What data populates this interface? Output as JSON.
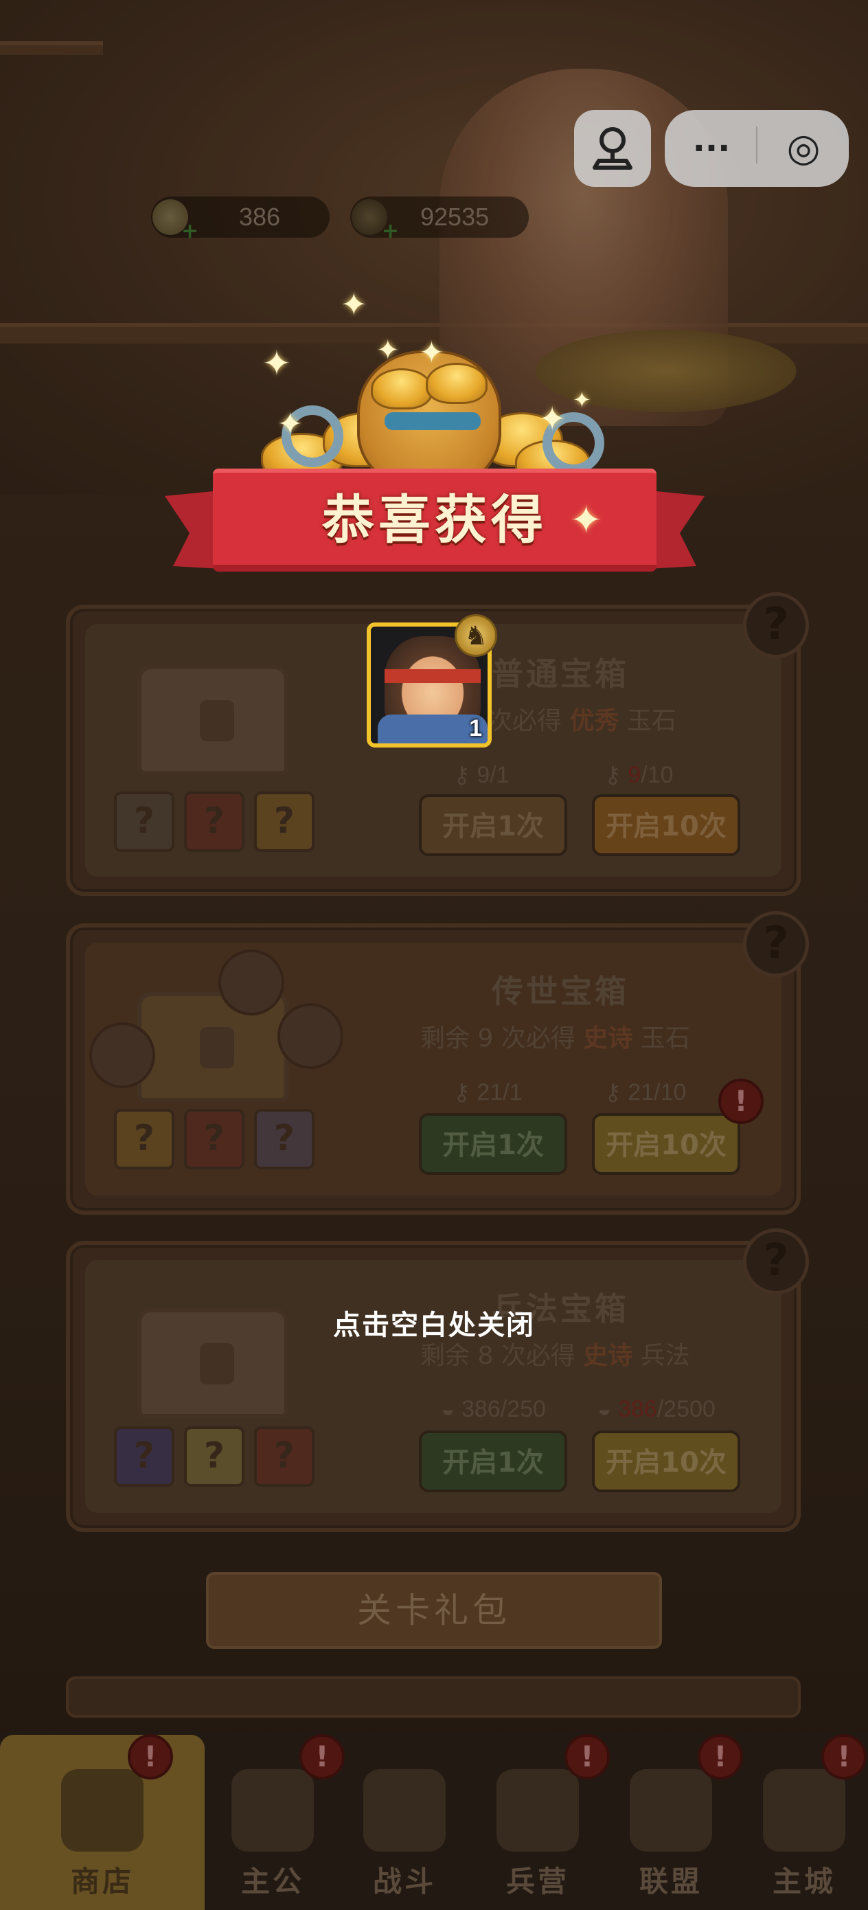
{
  "resources": {
    "ingot_count": "386",
    "coin_count": "92535"
  },
  "capsule": {
    "more_glyph": "···",
    "close_glyph": "◎"
  },
  "reward_popup": {
    "title": "恭喜获得",
    "item": {
      "type": "hero",
      "count": "1"
    },
    "close_hint": "点击空白处关闭"
  },
  "boxes": [
    {
      "title": "普通宝箱",
      "sub_pre": "次必得",
      "sub_bold": "优秀",
      "sub_post": "玉石",
      "key_single": "9/1",
      "key_multi_red": "9",
      "key_multi_rest": "/10",
      "open_one": "开启1次",
      "open_ten": "开启10次"
    },
    {
      "title": "传世宝箱",
      "sub_pre": "剩余 9 次必得",
      "sub_bold": "史诗",
      "sub_post": "玉石",
      "key_single": "21/1",
      "key_multi": "21/10",
      "open_one": "开启1次",
      "open_ten": "开启10次"
    },
    {
      "title": "兵法宝箱",
      "sub_pre": "剩余 8 次必得",
      "sub_bold": "史诗",
      "sub_post": "兵法",
      "key_single": "386/250",
      "key_multi_red": "386",
      "key_multi_rest": "/2500",
      "open_one": "开启1次",
      "open_ten": "开启10次"
    }
  ],
  "level_pack": "关卡礼包",
  "nav": [
    {
      "label": "商店",
      "active": true,
      "badge": "!"
    },
    {
      "label": "主公",
      "active": false,
      "badge": "!"
    },
    {
      "label": "战斗",
      "active": false
    },
    {
      "label": "兵营",
      "active": false,
      "badge": "!"
    },
    {
      "label": "联盟",
      "active": false,
      "badge": "!"
    },
    {
      "label": "主城",
      "active": false,
      "badge": "!"
    }
  ],
  "colors": {
    "ribbon_red": "#d7323b",
    "card_border_gold": "#f2c32a",
    "banner_text": "#fff2d0"
  }
}
